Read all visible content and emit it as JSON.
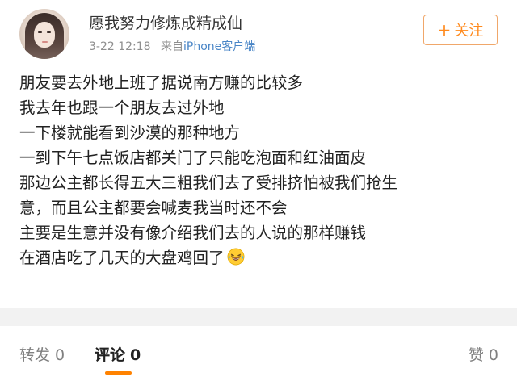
{
  "user": {
    "name": "愿我努力修炼成精成仙",
    "time": "3-22 12:18",
    "source_prefix": "来自",
    "source_link": "iPhone客户端"
  },
  "follow": {
    "plus": "+",
    "label": "关注"
  },
  "post": {
    "lines": [
      "朋友要去外地上班了据说南方赚的比较多",
      "我去年也跟一个朋友去过外地",
      "一下楼就能看到沙漠的那种地方",
      "一到下午七点饭店都关门了只能吃泡面和红油面皮",
      "那边公主都长得五大三粗我们去了受排挤怕被我们抢生",
      "意，而且公主都要会喊麦我当时还不会",
      "主要是生意并没有像介绍我们去的人说的那样赚钱",
      "在酒店吃了几天的大盘鸡回了"
    ],
    "emoji": "laughing-with-tears-icon"
  },
  "tabs": {
    "repost": {
      "label": "转发",
      "count": "0"
    },
    "comment": {
      "label": "评论",
      "count": "0"
    },
    "like": {
      "label": "赞",
      "count": "0"
    }
  },
  "colors": {
    "accent": "#ff8200",
    "link": "#4a86c7",
    "follow_border": "#f0a76a"
  }
}
